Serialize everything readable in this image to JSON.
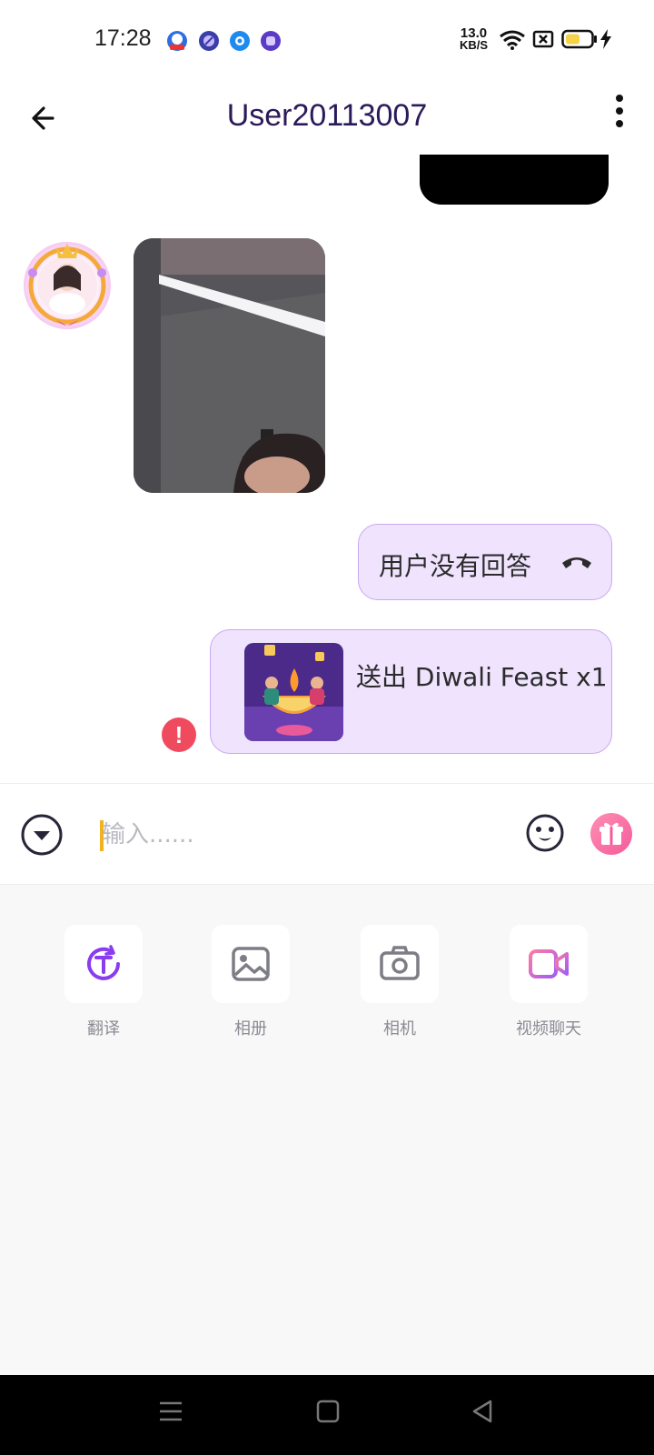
{
  "status_bar": {
    "time": "17:28",
    "net_speed_value": "13.0",
    "net_speed_unit": "KB/S",
    "icons": [
      "baidu-app-icon",
      "app-notification-icon",
      "app-notification-icon",
      "app-notification-icon",
      "wifi-icon",
      "sim-off-icon",
      "battery-icon",
      "charging-icon"
    ]
  },
  "header": {
    "title": "User20113007",
    "back_icon": "arrow-left-icon",
    "menu_icon": "more-vertical-icon"
  },
  "chat": {
    "messages": [
      {
        "direction": "outgoing",
        "type": "media-partial"
      },
      {
        "direction": "incoming",
        "type": "photo"
      },
      {
        "direction": "outgoing",
        "type": "call",
        "text": "用户没有回答",
        "icon": "phone-hangup-icon"
      },
      {
        "direction": "outgoing",
        "type": "gift",
        "text": "送出 Diwali Feast x1",
        "status": "failed",
        "status_icon": "!"
      }
    ]
  },
  "input_bar": {
    "placeholder": "输入......",
    "value": ""
  },
  "tools": [
    {
      "label": "翻译",
      "icon": "translate-icon"
    },
    {
      "label": "相册",
      "icon": "gallery-icon"
    },
    {
      "label": "相机",
      "icon": "camera-icon"
    },
    {
      "label": "视频聊天",
      "icon": "video-chat-icon"
    }
  ],
  "colors": {
    "accent": "#8a3cf0",
    "bubble_bg": "#efe3fd",
    "bubble_border": "#c9a8f2",
    "error": "#f04a5f",
    "title": "#2b1a5a"
  }
}
